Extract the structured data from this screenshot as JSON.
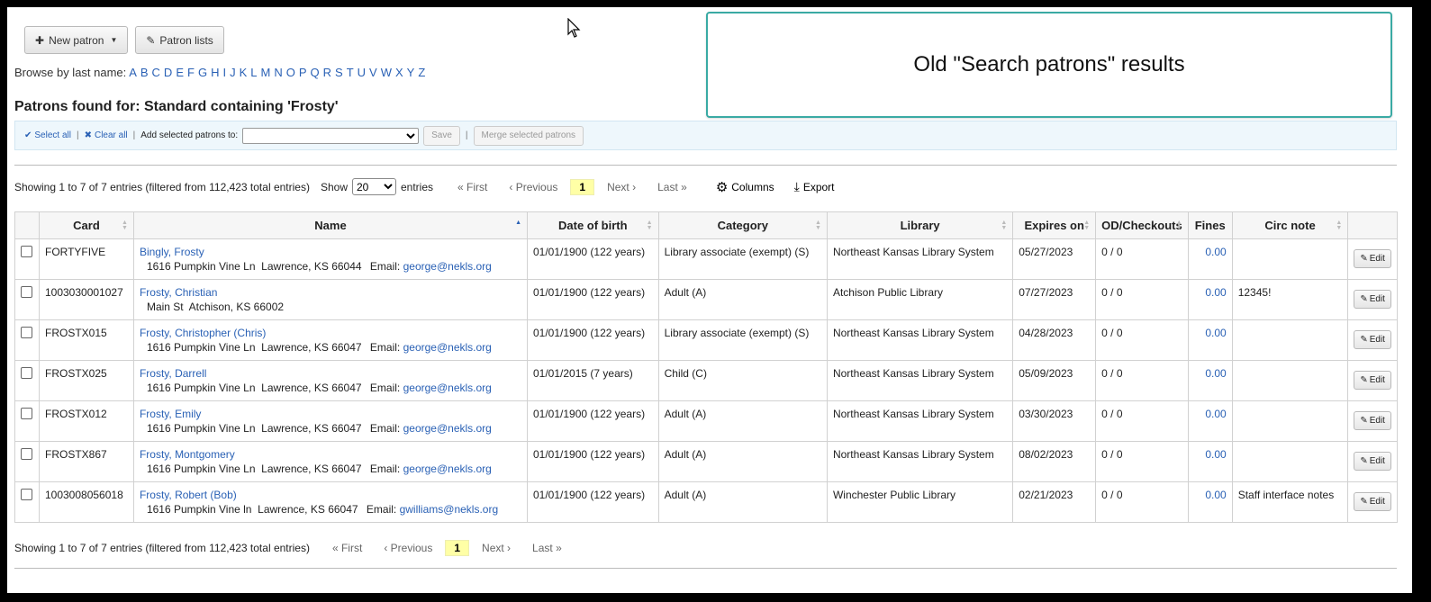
{
  "toolbar": {
    "new_patron": "New patron",
    "patron_lists": "Patron lists"
  },
  "browse": {
    "label": "Browse by last name:",
    "letters": [
      "A",
      "B",
      "C",
      "D",
      "E",
      "F",
      "G",
      "H",
      "I",
      "J",
      "K",
      "L",
      "M",
      "N",
      "O",
      "P",
      "Q",
      "R",
      "S",
      "T",
      "U",
      "V",
      "W",
      "X",
      "Y",
      "Z"
    ]
  },
  "title": "Patrons found for: Standard containing 'Frosty'",
  "selection_bar": {
    "select_all": "Select all",
    "clear_all": "Clear all",
    "add_label": "Add selected patrons to:",
    "list_value": "",
    "save": "Save",
    "merge": "Merge selected patrons"
  },
  "table_info": "Showing 1 to 7 of 7 entries (filtered from 112,423 total entries)",
  "length": {
    "show": "Show",
    "value": "20",
    "entries": "entries"
  },
  "pager": {
    "first": "« First",
    "previous": "‹ Previous",
    "current": "1",
    "next": "Next ›",
    "last": "Last »"
  },
  "tools": {
    "columns": "Columns",
    "export": "Export"
  },
  "columns": [
    "",
    "Card",
    "Name",
    "Date of birth",
    "Category",
    "Library",
    "Expires on",
    "OD/Checkouts",
    "Fines",
    "Circ note",
    ""
  ],
  "rows": [
    {
      "card": "FORTYFIVE",
      "name": "Bingly, Frosty",
      "address": "1616 Pumpkin Vine Ln  Lawrence, KS 66044",
      "email_label": "Email:",
      "email": "george@nekls.org",
      "dob": "01/01/1900 (122 years)",
      "category": "Library associate (exempt) (S)",
      "library": "Northeast Kansas Library System",
      "expires": "05/27/2023",
      "od": "0 / 0",
      "fines": "0.00",
      "note": "",
      "edit": "Edit"
    },
    {
      "card": "1003030001027",
      "name": "Frosty, Christian",
      "address": "Main St  Atchison, KS 66002",
      "email_label": "",
      "email": "",
      "dob": "01/01/1900 (122 years)",
      "category": "Adult (A)",
      "library": "Atchison Public Library",
      "expires": "07/27/2023",
      "od": "0 / 0",
      "fines": "0.00",
      "note": "12345!",
      "edit": "Edit"
    },
    {
      "card": "FROSTX015",
      "name": "Frosty, Christopher (Chris)",
      "address": "1616 Pumpkin Vine Ln  Lawrence, KS 66047",
      "email_label": "Email:",
      "email": "george@nekls.org",
      "dob": "01/01/1900 (122 years)",
      "category": "Library associate (exempt) (S)",
      "library": "Northeast Kansas Library System",
      "expires": "04/28/2023",
      "od": "0 / 0",
      "fines": "0.00",
      "note": "",
      "edit": "Edit"
    },
    {
      "card": "FROSTX025",
      "name": "Frosty, Darrell",
      "address": "1616 Pumpkin Vine Ln  Lawrence, KS 66047",
      "email_label": "Email:",
      "email": "george@nekls.org",
      "dob": "01/01/2015 (7 years)",
      "category": "Child (C)",
      "library": "Northeast Kansas Library System",
      "expires": "05/09/2023",
      "od": "0 / 0",
      "fines": "0.00",
      "note": "",
      "edit": "Edit"
    },
    {
      "card": "FROSTX012",
      "name": "Frosty, Emily",
      "address": "1616 Pumpkin Vine Ln  Lawrence, KS 66047",
      "email_label": "Email:",
      "email": "george@nekls.org",
      "dob": "01/01/1900 (122 years)",
      "category": "Adult (A)",
      "library": "Northeast Kansas Library System",
      "expires": "03/30/2023",
      "od": "0 / 0",
      "fines": "0.00",
      "note": "",
      "edit": "Edit"
    },
    {
      "card": "FROSTX867",
      "name": "Frosty, Montgomery",
      "address": "1616 Pumpkin Vine Ln  Lawrence, KS 66047",
      "email_label": "Email:",
      "email": "george@nekls.org",
      "dob": "01/01/1900 (122 years)",
      "category": "Adult (A)",
      "library": "Northeast Kansas Library System",
      "expires": "08/02/2023",
      "od": "0 / 0",
      "fines": "0.00",
      "note": "",
      "edit": "Edit"
    },
    {
      "card": "1003008056018",
      "name": "Frosty, Robert (Bob)",
      "address": "1616 Pumpkin Vine ln  Lawrence, KS 66047",
      "email_label": "Email:",
      "email": "gwilliams@nekls.org",
      "dob": "01/01/1900 (122 years)",
      "category": "Adult (A)",
      "library": "Winchester Public Library",
      "expires": "02/21/2023",
      "od": "0 / 0",
      "fines": "0.00",
      "note": "Staff interface notes",
      "edit": "Edit"
    }
  ],
  "callout": "Old \"Search patrons\" results",
  "colors": {
    "link": "#2a61b5",
    "callout_border": "#3aaaa4",
    "current_page": "#ffffa6",
    "selection_bar": "#eef7fc"
  }
}
